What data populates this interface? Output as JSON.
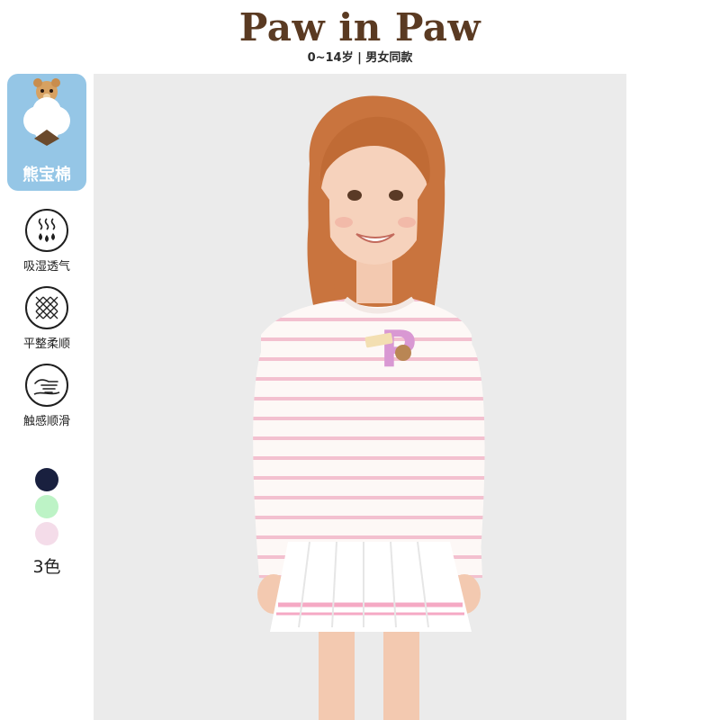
{
  "brand": {
    "title": "Paw in Paw",
    "subtitle": "0~14岁 | 男女同款"
  },
  "badge": {
    "label": "熊宝棉",
    "icon": "bear-cotton-icon",
    "color": "#95c6e6"
  },
  "features": [
    {
      "label": "吸湿透气",
      "icon": "moisture-wicking-icon"
    },
    {
      "label": "平整柔顺",
      "icon": "smooth-mesh-icon"
    },
    {
      "label": "触感顺滑",
      "icon": "soft-touch-icon"
    }
  ],
  "colors": {
    "swatches": [
      "#19203f",
      "#bdf3c6",
      "#f4dce9"
    ],
    "count_label": "3色"
  },
  "photo": {
    "subject": "product-photo-girl-striped-top",
    "background": "#ebebeb"
  }
}
